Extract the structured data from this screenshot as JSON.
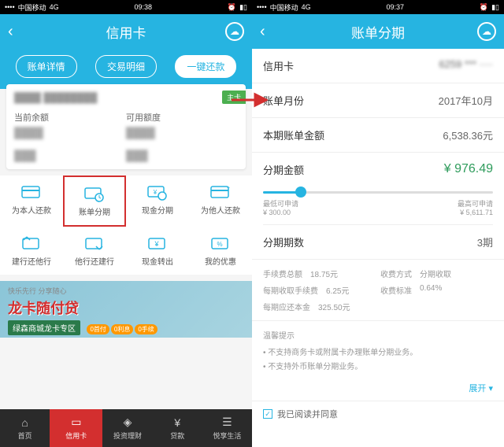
{
  "left": {
    "status": {
      "carrier": "中国移动",
      "net": "4G",
      "time": "09:38"
    },
    "header": {
      "title": "信用卡"
    },
    "tabs": [
      "账单详情",
      "交易明细",
      "一键还款"
    ],
    "card": {
      "badge": "主卡",
      "row1": {
        "l": "当前余额",
        "r": "可用额度"
      }
    },
    "grid": [
      {
        "label": "为本人还款"
      },
      {
        "label": "账单分期"
      },
      {
        "label": "现金分期"
      },
      {
        "label": "为他人还款"
      },
      {
        "label": "建行还他行"
      },
      {
        "label": "他行还建行"
      },
      {
        "label": "现金转出"
      },
      {
        "label": "我的优惠"
      }
    ],
    "banner": {
      "tag": "快乐先行 分享随心",
      "title": "龙卡随付贷",
      "sub": "绿森商城龙卡专区",
      "pills": [
        "0首付",
        "0利息",
        "0手续"
      ]
    },
    "nav": [
      "首页",
      "信用卡",
      "投资理财",
      "贷款",
      "悦享生活"
    ]
  },
  "right": {
    "status": {
      "carrier": "中国移动",
      "net": "4G",
      "time": "09:37"
    },
    "header": {
      "title": "账单分期"
    },
    "rows": {
      "card": {
        "l": "信用卡",
        "v": "6259 *** ····"
      },
      "month": {
        "l": "账单月份",
        "v": "2017年10月"
      },
      "amount": {
        "l": "本期账单金额",
        "v": "6,538.36元"
      },
      "install": {
        "l": "分期金额",
        "v": "¥ 976.49"
      },
      "period": {
        "l": "分期期数",
        "v": "3期"
      }
    },
    "slider": {
      "min_l": "最低可申请",
      "min_v": "¥ 300.00",
      "max_l": "最高可申请",
      "max_v": "¥ 5,611.71"
    },
    "fees": {
      "f1l": "手续费总额",
      "f1v": "18.75元",
      "f2l": "收费方式",
      "f2v": "分期收取",
      "f3l": "每期收取手续费",
      "f3v": "6.25元",
      "f4l": "收费标准",
      "f4v": "0.64%",
      "f5l": "每期应还本金",
      "f5v": "325.50元"
    },
    "warm": {
      "title": "温馨提示",
      "i1": "• 不支持商务卡或附属卡办理账单分期业务。",
      "i2": "• 不支持外币账单分期业务。"
    },
    "expand": "展开 ▾",
    "agree": "我已阅读并同意"
  }
}
